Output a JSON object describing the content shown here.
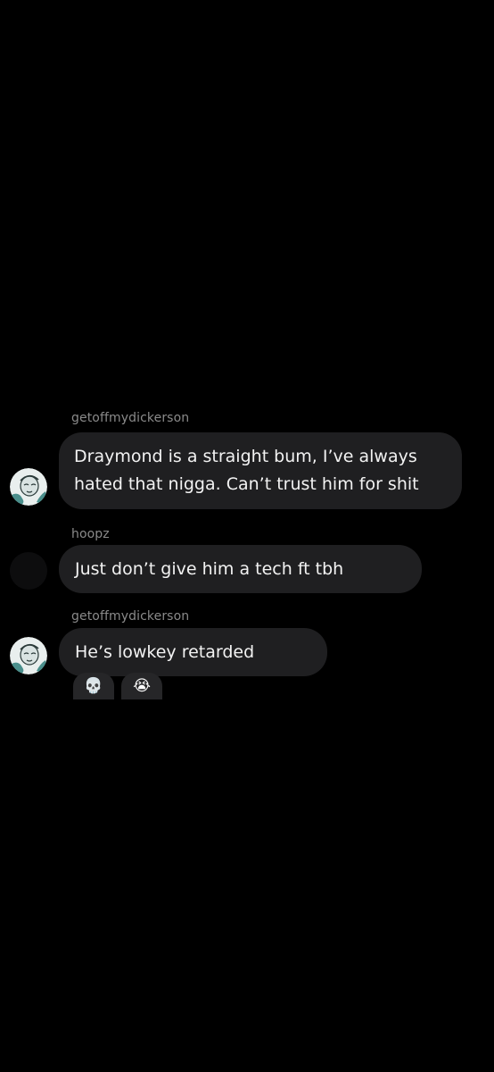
{
  "messages": [
    {
      "sender": "getoffmydickerson",
      "lines": [
        "Draymond is a straight bum, I’ve always",
        "hated that nigga. Can’t trust him for shit"
      ]
    },
    {
      "sender": "hoopz",
      "lines": [
        "Just don’t give him a tech ft tbh"
      ]
    },
    {
      "sender": "getoffmydickerson",
      "lines": [
        "He’s lowkey retarded"
      ]
    }
  ],
  "reactions": [
    {
      "emoji": "💀",
      "icon": "skull-emoji"
    },
    {
      "emoji": "😭",
      "icon": "loudly-crying-face-emoji"
    }
  ],
  "colors": {
    "background": "#000000",
    "bubble": "#1f1f21",
    "sender_text": "#8a8a8a",
    "message_text": "#f2f2f2",
    "avatar_teal": "#4a8f8c"
  }
}
